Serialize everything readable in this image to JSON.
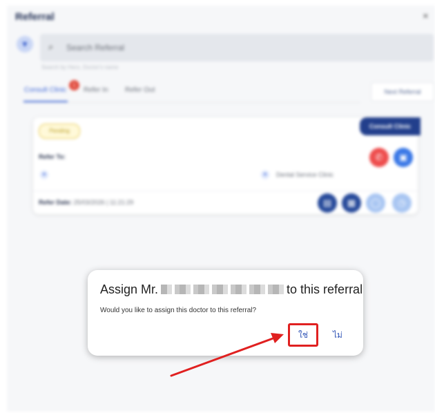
{
  "panel": {
    "title": "Referral",
    "close_icon": "×",
    "filter_icon": "filter-icon",
    "search": {
      "icon": "search-icon",
      "placeholder": "Search Referral",
      "hint": "Search by Hero, Doctor's name"
    },
    "tabs": [
      {
        "label": "Consult Clinic",
        "badge": "1"
      },
      {
        "label": "Refer In"
      },
      {
        "label": "Refer Out"
      }
    ],
    "next_button": "Next Referral",
    "card": {
      "status": "Pending",
      "type_tag": "Consult Clinic",
      "refer_to_label": "Refer To:",
      "clinic": "Dental Service Clinic",
      "refer_date_label": "Refer Date:",
      "refer_date_value": "25/03/2026 | 11:21:29"
    }
  },
  "dialog": {
    "title_prefix": "Assign Mr.",
    "title_suffix": "to this referral",
    "message": "Would you like to assign this doctor to this referral?",
    "yes_label": "ใช่",
    "no_label": "ไม่"
  },
  "annotation": {
    "color": "#e02020"
  }
}
